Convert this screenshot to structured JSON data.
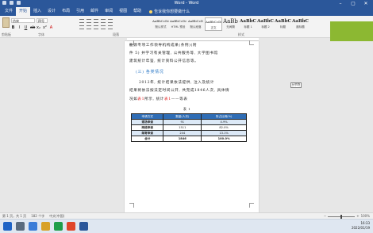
{
  "window": {
    "title": "Word - Word"
  },
  "tabs": [
    "文件",
    "开始",
    "插入",
    "设计",
    "布局",
    "引用",
    "邮件",
    "审阅",
    "视图",
    "帮助"
  ],
  "tell_me": "告诉我你想要做什么",
  "ribbon": {
    "paste_label": "粘贴",
    "font_name": "仿宋",
    "font_size": "四号",
    "format_buttons": [
      "B",
      "I",
      "U",
      "ab",
      "x₂",
      "x²",
      "A"
    ],
    "group_labels": {
      "clipboard": "剪贴板",
      "font": "字体",
      "paragraph": "段落",
      "styles": "样式"
    },
    "styles": [
      {
        "sample": "AaBbCcDd",
        "name": "默认样式"
      },
      {
        "sample": "AaBbCcDd",
        "name": "HTML 预设"
      },
      {
        "sample": "AaBbCcD",
        "name": "默认段落"
      },
      {
        "sample": "AaBbCcDd",
        "name": "正文"
      },
      {
        "sample": "AaBb",
        "name": "无间隔"
      },
      {
        "sample": "AaBbC",
        "name": "标题 1"
      },
      {
        "sample": "AaBbC",
        "name": "标题 2"
      },
      {
        "sample": "AaBbC",
        "name": "标题"
      },
      {
        "sample": "AaBbC",
        "name": "副标题"
      }
    ]
  },
  "document": {
    "line1": "能源专项工作领导机构成果(条例)(附",
    "line2": "件 5) 并学习有关管理, 公共服务等, 大学图书馆",
    "line3": "建筑统计年鉴, 统计资料公开信息等。",
    "heading": "(三) 各类情况",
    "para1": "2012年, 统计结果依法提供, 注入及统计",
    "para2": "结果将依法按法定时间公开, 共完成1846人次, 具体情",
    "para3_prefix": "况如",
    "para3_red": "表1",
    "para3_suffix": "所示, 统计",
    "para3_red2": "表1",
    "para3_end": "——等表",
    "table_caption": "表 1",
    "table": {
      "headers": [
        "申请方式",
        "数量(人次)",
        "所占比例(%)"
      ],
      "rows": [
        [
          "现场申请",
          "91",
          "4.9%"
        ],
        [
          "网络申请",
          "1511",
          "82.0%"
        ],
        [
          "邮寄申请",
          "244",
          "13.1%"
        ],
        [
          "合计",
          "1846",
          "100.0%"
        ]
      ]
    }
  },
  "side_chip": "分节符",
  "status": {
    "page": "第 1 页，共 1 页",
    "words": "182 个字",
    "lang": "中文(中国)",
    "zoom": "100%",
    "zoom_level": 0.5
  },
  "tray": {
    "time": "16:33",
    "date": "2022/01/19"
  },
  "colors": {
    "accent": "#2b579a",
    "heading_blue": "#2b78c6",
    "table_header": "#2f6db5",
    "green_block": "#8cb832"
  }
}
